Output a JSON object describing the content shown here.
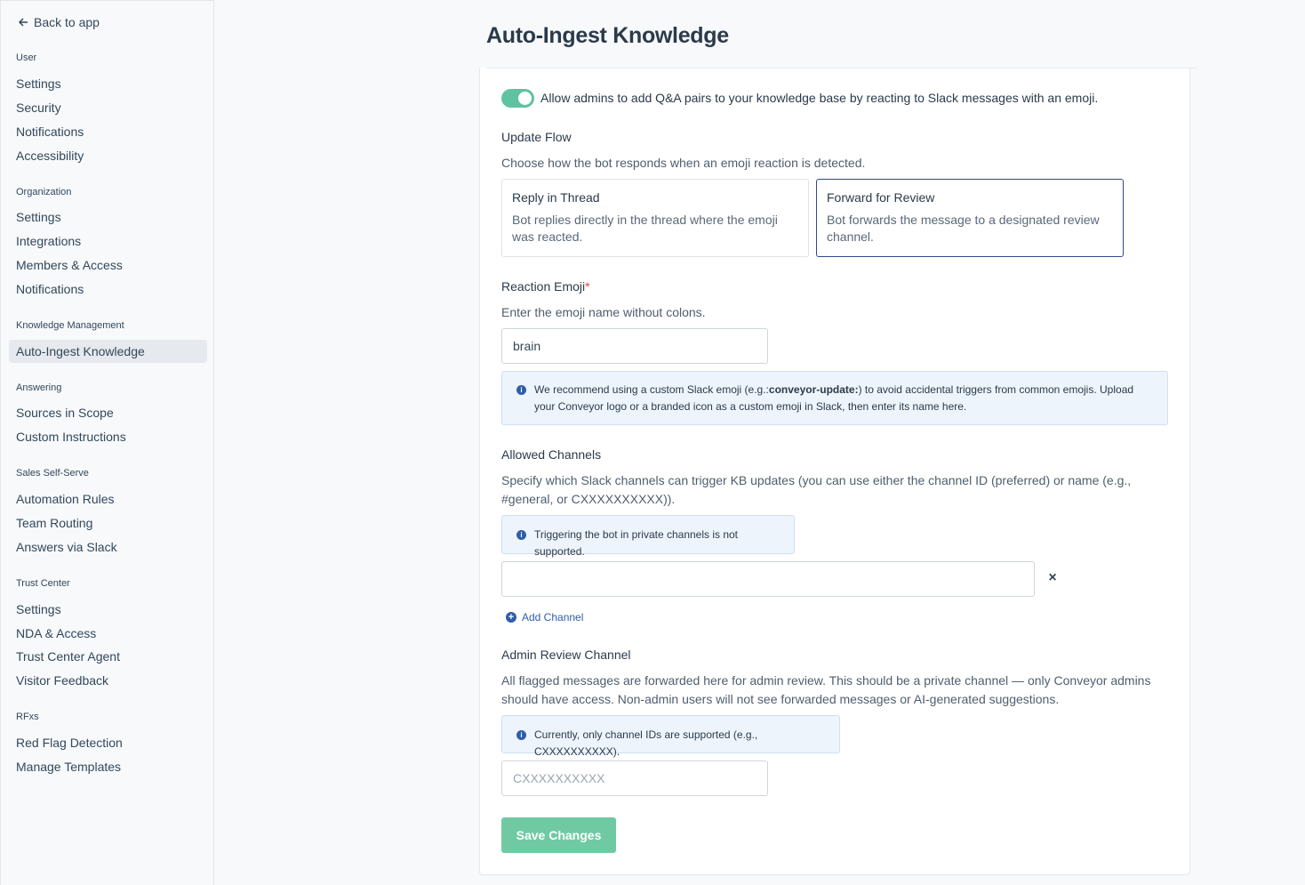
{
  "sidebar": {
    "back_label": "Back to app",
    "sections": {
      "user": {
        "title": "User",
        "items": [
          "Settings",
          "Security",
          "Notifications",
          "Accessibility"
        ]
      },
      "organization": {
        "title": "Organization",
        "items": [
          "Settings",
          "Integrations",
          "Members & Access",
          "Notifications"
        ]
      },
      "knowledge": {
        "title": "Knowledge Management",
        "items": [
          "Auto-Ingest Knowledge"
        ]
      },
      "answering": {
        "title": "Answering",
        "items": [
          "Sources in Scope",
          "Custom Instructions"
        ]
      },
      "sales": {
        "title": "Sales Self-Serve",
        "items": [
          "Automation Rules",
          "Team Routing",
          "Answers via Slack"
        ]
      },
      "trust": {
        "title": "Trust Center",
        "items": [
          "Settings",
          "NDA & Access",
          "Trust Center Agent",
          "Visitor Feedback"
        ]
      },
      "rfxs": {
        "title": "RFxs",
        "items": [
          "Red Flag Detection",
          "Manage Templates"
        ]
      }
    },
    "active_item": "Auto-Ingest Knowledge"
  },
  "main": {
    "title": "Auto-Ingest Knowledge",
    "toggle": {
      "enabled": true,
      "label": "Allow admins to add Q&A pairs to your knowledge base by reacting to Slack messages with an emoji."
    },
    "update_flow": {
      "label": "Update Flow",
      "description": "Choose how the bot responds when an emoji reaction is detected.",
      "options": [
        {
          "title": "Reply in Thread",
          "description": "Bot replies directly in the thread where the emoji was reacted."
        },
        {
          "title": "Forward for Review",
          "description": "Bot forwards the message to a designated review channel."
        }
      ],
      "selected": "Forward for Review"
    },
    "reaction_emoji": {
      "label": "Reaction Emoji",
      "required_mark": "*",
      "description": "Enter the emoji name without colons.",
      "value": "brain",
      "info_pre": "We recommend using a custom Slack emoji (e.g.:",
      "info_code": "conveyor-update:",
      "info_post": ") to avoid accidental triggers from common emojis. Upload your Conveyor logo or a branded icon as a custom emoji in Slack, then enter its name here."
    },
    "allowed_channels": {
      "label": "Allowed Channels",
      "description": "Specify which Slack channels can trigger KB updates (you can use either the channel ID (preferred) or name (e.g., #general, or CXXXXXXXXXX)).",
      "info": "Triggering the bot in private channels is not supported.",
      "channel_value": "",
      "remove_label": "×",
      "add_label": "Add Channel"
    },
    "admin_review": {
      "label": "Admin Review Channel",
      "description": "All flagged messages are forwarded here for admin review. This should be a private channel — only Conveyor admins should have access. Non-admin users will not see forwarded messages or AI-generated suggestions.",
      "info": "Currently, only channel IDs are supported (e.g., CXXXXXXXXXX).",
      "placeholder": "CXXXXXXXXXX"
    },
    "save_label": "Save Changes"
  },
  "colors": {
    "accent_green": "#5fc2a0",
    "save_green": "#6fcaa4",
    "selected_border": "#2f4a8a",
    "info_bg": "#eef4fc",
    "link_blue": "#2f5ea8"
  }
}
